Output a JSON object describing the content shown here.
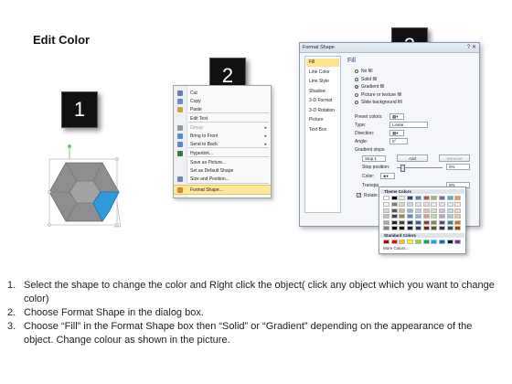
{
  "title": "Edit Color",
  "steps": [
    "1",
    "2",
    "3"
  ],
  "context_menu": {
    "items": [
      {
        "label": "Cut",
        "icon": "scissors-icon",
        "color": "#6a7fa8"
      },
      {
        "label": "Copy",
        "icon": "copy-icon",
        "color": "#6a8fc8"
      },
      {
        "label": "Paste",
        "icon": "paste-icon",
        "color": "#c9a44a"
      },
      {
        "label": "Edit Text",
        "icon": "",
        "color": ""
      },
      {
        "label": "Group",
        "icon": "group-icon",
        "color": "#8899aa",
        "submenu": true,
        "disabled": true
      },
      {
        "label": "Bring to Front",
        "icon": "bring-front-icon",
        "color": "#5a8ad0",
        "submenu": true
      },
      {
        "label": "Send to Back",
        "icon": "send-back-icon",
        "color": "#5a8ad0",
        "submenu": true
      },
      {
        "label": "Hyperlink...",
        "icon": "hyperlink-icon",
        "color": "#3a7a3a"
      },
      {
        "label": "Save as Picture...",
        "icon": "",
        "color": ""
      },
      {
        "label": "Set as Default Shape",
        "icon": "",
        "color": ""
      },
      {
        "label": "Size and Position...",
        "icon": "size-icon",
        "color": "#6a8ab8"
      },
      {
        "label": "Format Shape...",
        "icon": "format-shape-icon",
        "color": "#d08a2a",
        "highlighted": true
      }
    ]
  },
  "dialog": {
    "title": "Format Shape",
    "close_glyph": "?  ✕",
    "categories": [
      "Fill",
      "Line Color",
      "Line Style",
      "Shadow",
      "3-D Format",
      "3-D Rotation",
      "Picture",
      "Text Box"
    ],
    "selected_category": "Fill",
    "heading": "Fill",
    "options": [
      "No fill",
      "Solid fill",
      "Gradient fill",
      "Picture or texture fill",
      "Slide background fill"
    ],
    "selected_option": "Gradient fill",
    "preset_colors_label": "Preset colors:",
    "type_label": "Type:",
    "type_value": "Linear",
    "direction_label": "Direction:",
    "angle_label": "Angle:",
    "angle_value": "0°",
    "gradient_stops_label": "Gradient stops",
    "stop_value": "Stop 1",
    "add_button": "Add",
    "remove_button": "Remove",
    "stop_position_label": "Stop position:",
    "stop_position_value": "0%",
    "color_label": "Color:",
    "transparency_label": "Transpa",
    "transparency_value": "0%",
    "rotate_label": "Rotate",
    "rotate_checked": true
  },
  "picker": {
    "theme_header": "Theme Colors",
    "standard_header": "Standard Colors",
    "more": "More Colors...",
    "theme_top": [
      "#ffffff",
      "#000000",
      "#eeece1",
      "#1f497d",
      "#4f81bd",
      "#c0504d",
      "#9bbb59",
      "#8064a2",
      "#4bacc6",
      "#f79646"
    ],
    "theme_columns": [
      [
        "#f2f2f2",
        "#d9d9d9",
        "#bfbfbf",
        "#a6a6a6",
        "#7f7f7f"
      ],
      [
        "#7f7f7f",
        "#595959",
        "#404040",
        "#262626",
        "#0d0d0d"
      ],
      [
        "#ddd9c3",
        "#c4bd97",
        "#938953",
        "#494429",
        "#1d1b10"
      ],
      [
        "#c6d9f0",
        "#8db3e2",
        "#548dd4",
        "#17365d",
        "#0f243e"
      ],
      [
        "#dbe5f1",
        "#b8cce4",
        "#95b3d7",
        "#366092",
        "#244061"
      ],
      [
        "#f2dcdb",
        "#e5b9b7",
        "#d99694",
        "#953734",
        "#632423"
      ],
      [
        "#ebf1dd",
        "#d7e3bc",
        "#c3d69b",
        "#76923c",
        "#4f6128"
      ],
      [
        "#e5e0ec",
        "#ccc1d9",
        "#b2a2c7",
        "#5f497a",
        "#3f3151"
      ],
      [
        "#dbeef3",
        "#b7dde8",
        "#92cddc",
        "#31859b",
        "#205867"
      ],
      [
        "#fdeada",
        "#fbd5b5",
        "#fac08f",
        "#e36c09",
        "#974806"
      ]
    ],
    "standard": [
      "#c00000",
      "#ff0000",
      "#ffc000",
      "#ffff00",
      "#92d050",
      "#00b050",
      "#00b0f0",
      "#0070c0",
      "#002060",
      "#7030a0"
    ]
  },
  "shape": {
    "body_color": "#8e8e8e",
    "piece_color": "#a3a3a3",
    "accent_color": "#2f9bdc"
  },
  "instructions": [
    {
      "num": "1.",
      "text": "Select the shape to change the color and Right click the object( click any object which you want to change color)"
    },
    {
      "num": "2.",
      "text": "Choose Format Shape in the dialog box."
    },
    {
      "num": "3.",
      "text": "Choose “Fill” in the Format Shape box then “Solid” or “Gradient” depending on the appearance of the object. Change colour as shown in the picture."
    }
  ]
}
